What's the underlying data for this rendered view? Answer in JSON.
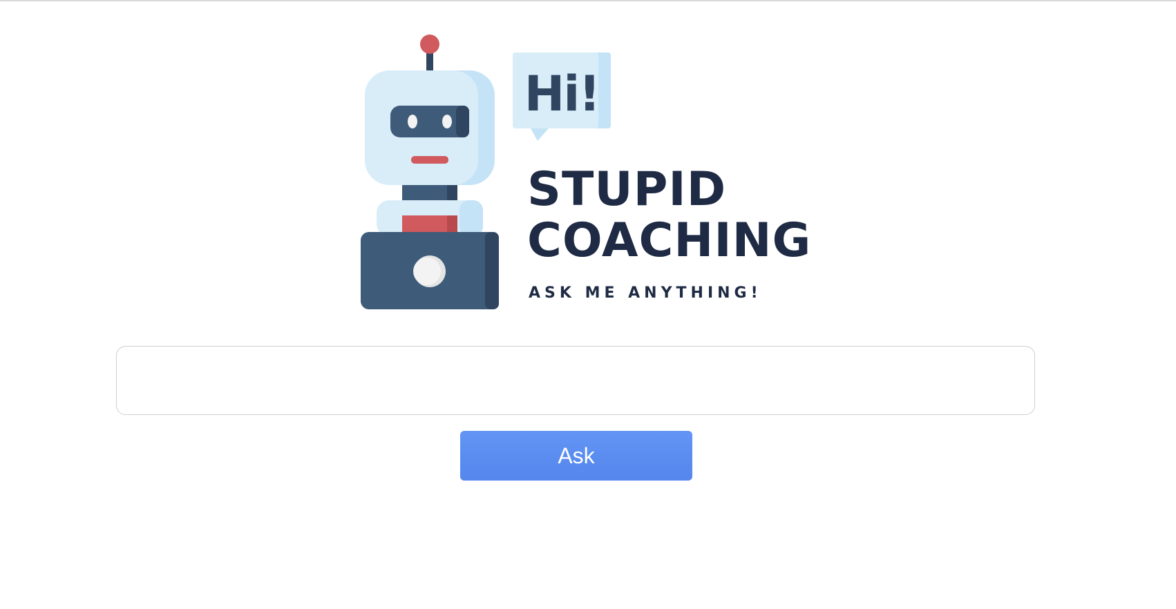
{
  "logo": {
    "bubble_text": "Hi!",
    "title_line1": "STUPID",
    "title_line2": "COACHING",
    "tagline": "ASK ME ANYTHING!",
    "colors": {
      "navy": "#1f2b45",
      "slate": "#3e5b7a",
      "light_blue": "#d9edf9",
      "red": "#d05a5d"
    }
  },
  "form": {
    "question_value": "",
    "question_placeholder": "",
    "ask_label": "Ask",
    "accent_color": "#5a8ef2"
  }
}
